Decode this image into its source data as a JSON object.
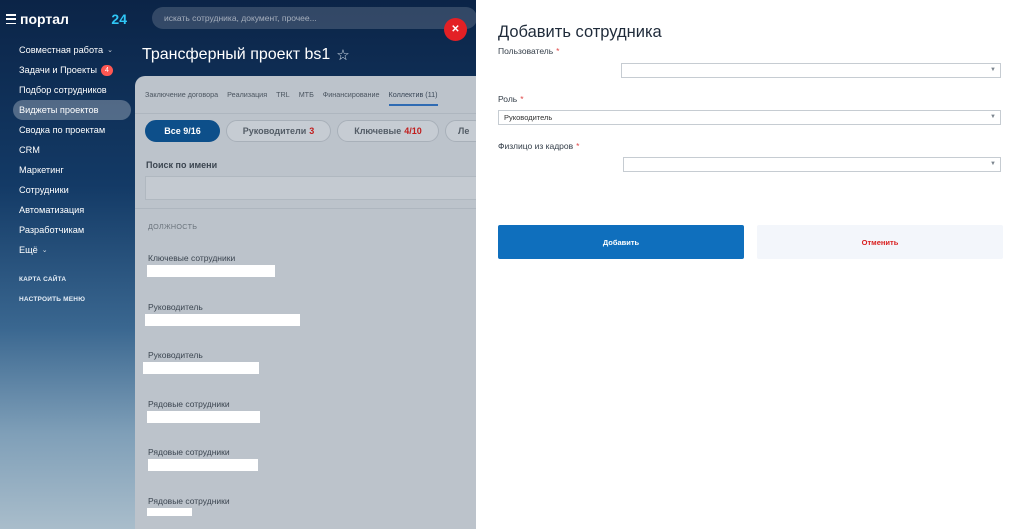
{
  "sidebar": {
    "logo": "портал",
    "logo_suffix": "24",
    "items": [
      {
        "label": "Совместная работа"
      },
      {
        "label": "Задачи и Проекты",
        "badge": "4"
      },
      {
        "label": "Подбор сотрудников"
      },
      {
        "label": "Виджеты проектов"
      },
      {
        "label": "Сводка по проектам"
      },
      {
        "label": "CRM"
      },
      {
        "label": "Маркетинг"
      },
      {
        "label": "Сотрудники"
      },
      {
        "label": "Автоматизация"
      },
      {
        "label": "Разработчикам"
      },
      {
        "label": "Ещё"
      }
    ],
    "site_map": "КАРТА САЙТА",
    "menu_setup": "НАСТРОИТЬ МЕНЮ"
  },
  "search": {
    "placeholder": "искать сотрудника, документ, прочее..."
  },
  "project": {
    "title": "Трансферный проект bs1"
  },
  "tabs": [
    "Заключение договора",
    "Реализация",
    "TRL",
    "MTБ",
    "Финансирование",
    "Коллектив (11)"
  ],
  "filters": [
    {
      "label": "Все 9/16"
    },
    {
      "label": "Руководители",
      "count": "3"
    },
    {
      "label": "Ключевые",
      "count": "4/10"
    },
    {
      "label": "Ле"
    }
  ],
  "name_search": {
    "label": "Поиск по имени"
  },
  "column_header": "ДОЛЖНОСТЬ",
  "rows": [
    {
      "role": "Ключевые сотрудники"
    },
    {
      "role": "Руководитель"
    },
    {
      "role": "Руководитель"
    },
    {
      "role": "Рядовые сотрудники"
    },
    {
      "role": "Рядовые сотрудники"
    },
    {
      "role": "Рядовые сотрудники"
    }
  ],
  "close_icon": "close-icon",
  "panel": {
    "title": "Добавить сотрудника",
    "user_label": "Пользователь",
    "role_label": "Роль",
    "role_value": "Руководитель",
    "person_label": "Физлицо из кадров",
    "required_mark": "*",
    "add_button": "Добавить",
    "cancel_button": "Отменить"
  },
  "colors": {
    "primary": "#0f6fbd",
    "danger": "#d91e1e",
    "accent": "#2fc6f6"
  }
}
